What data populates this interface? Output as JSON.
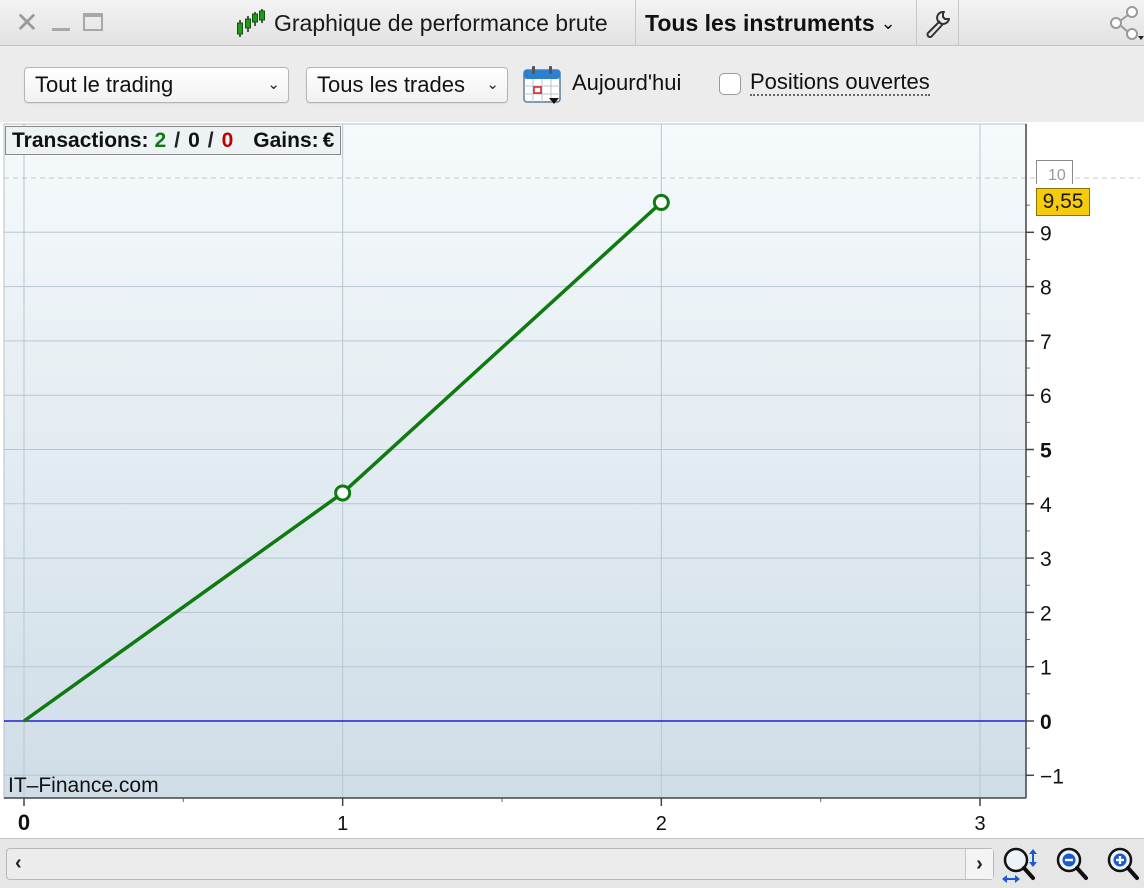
{
  "window": {
    "chart_title": "Graphique de performance brute",
    "instrument_filter": "Tous les instruments"
  },
  "controls": {
    "trading_filter": "Tout le trading",
    "trades_filter": "Tous les trades",
    "date_label": "Aujourd'hui",
    "open_positions_label": "Positions ouvertes",
    "open_positions_checked": false
  },
  "stats": {
    "transactions_label": "Transactions:",
    "total": "2",
    "neutral": "0",
    "losing": "0",
    "separator": "/",
    "gains_label": "Gains:",
    "gains_value": "€"
  },
  "watermark": "IT–Finance.com",
  "value_badge": "9,55",
  "colors": {
    "line": "#0f7a0f",
    "zero_line": "#2020d0",
    "badge": "#f5cb0d",
    "winning": "#0f7a0f",
    "losing": "#c00000"
  },
  "chart_data": {
    "type": "line",
    "x": [
      0,
      1,
      2
    ],
    "y": [
      0,
      4.2,
      9.55
    ],
    "xlim": [
      0,
      3
    ],
    "ylim": [
      -1,
      10
    ],
    "x_ticks": [
      "0",
      "1",
      "2",
      "3"
    ],
    "y_ticks": [
      "−1",
      "0",
      "1",
      "2",
      "3",
      "4",
      "5",
      "6",
      "7",
      "8",
      "9"
    ],
    "grid": true,
    "legend": "none"
  }
}
